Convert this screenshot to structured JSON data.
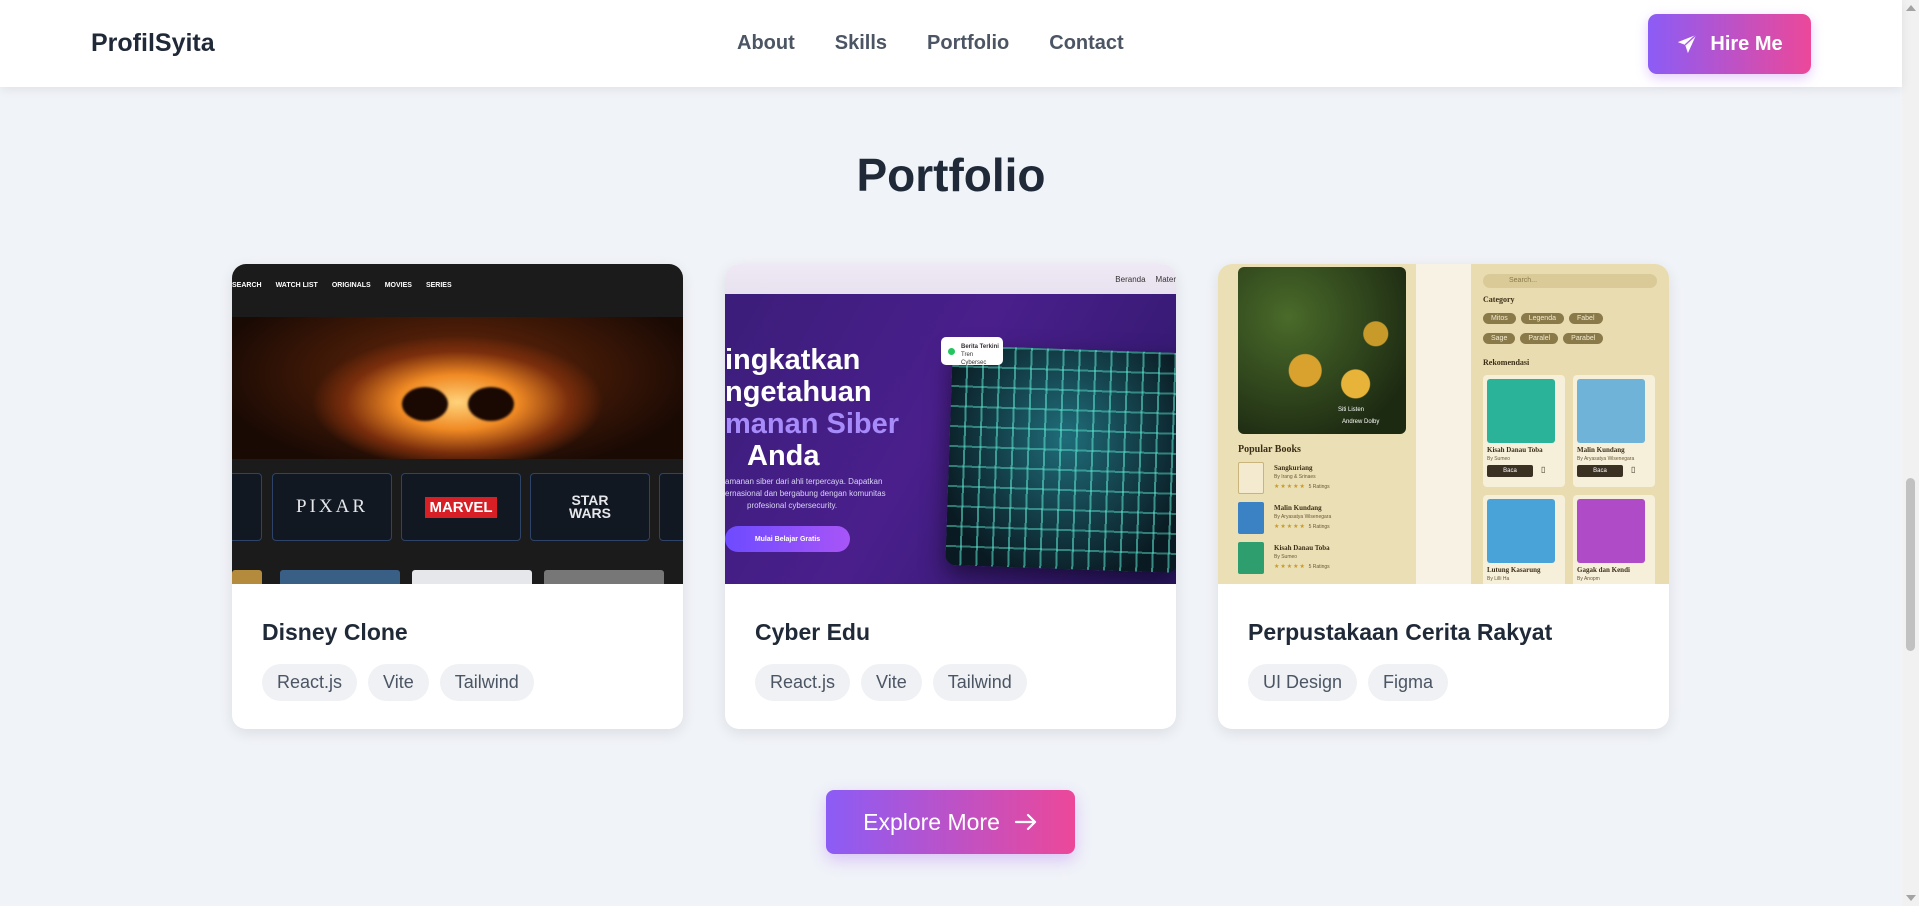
{
  "nav": {
    "logo": "ProfilSyita",
    "links": [
      "About",
      "Skills",
      "Portfolio",
      "Contact"
    ],
    "hire_label": "Hire Me"
  },
  "section": {
    "title": "Portfolio"
  },
  "projects": [
    {
      "title": "Disney Clone",
      "tags": [
        "React.js",
        "Vite",
        "Tailwind"
      ]
    },
    {
      "title": "Cyber Edu",
      "tags": [
        "React.js",
        "Vite",
        "Tailwind"
      ]
    },
    {
      "title": "Perpustakaan Cerita Rakyat",
      "tags": [
        "UI Design",
        "Figma"
      ]
    }
  ],
  "thumbs": {
    "disney": {
      "menu": [
        "SEARCH",
        "WATCH LIST",
        "ORIGINALS",
        "MOVIES",
        "SERIES"
      ],
      "brands": [
        "PIXAR",
        "MARVEL",
        "STAR WARS"
      ]
    },
    "cyber": {
      "nav": [
        "Beranda",
        "Mater"
      ],
      "line1": "ingkatkan",
      "line2": "ngetahuan",
      "line3": "manan Siber",
      "line4": "Anda",
      "para1": "amanan siber dari ahli terpercaya. Dapatkan",
      "para2": "ernasional dan bergabung dengan komunitas",
      "para3": "profesional cybersecurity.",
      "cta": "Mulai Belajar Gratis",
      "badge_title": "Berita Terkini",
      "badge_sub": "Tren Cybersec"
    },
    "library": {
      "listen": "Siti Listen",
      "author": "Andrew Dolby",
      "popular": "Popular Books",
      "popular_books": [
        {
          "title": "Sangkuriang",
          "by": "By Irang & Srinaes",
          "rating": "5 Ratings"
        },
        {
          "title": "Malin Kundang",
          "by": "By Aryasatya Wisenegara",
          "rating": "5 Ratings"
        },
        {
          "title": "Kisah Danau Toba",
          "by": "By Sumeo",
          "rating": "5 Ratings"
        }
      ],
      "search_placeholder": "Search...",
      "category_label": "Category",
      "categories_row1": [
        "Mitos",
        "Legenda",
        "Fabel"
      ],
      "categories_row2": [
        "Sage",
        "Paralel",
        "Parabel"
      ],
      "recommend_label": "Rekomendasi",
      "recommend": [
        {
          "title": "Kisah Danau Toba",
          "by": "By Sumeo",
          "cover_text": "Kisah Danau Toba",
          "btn": "Baca"
        },
        {
          "title": "Malin Kundang",
          "by": "By Aryasatya Wisenegara",
          "cover_text": "MALIN KUNDANG",
          "btn": "Baca"
        },
        {
          "title": "Lutung Kasarung",
          "by": "By Lilli Ha",
          "cover_text": "LUTUNG KASARUNG",
          "btn": ""
        },
        {
          "title": "Gagak dan Kendi",
          "by": "By Anopm",
          "cover_text": "Gagak dan Kendi",
          "btn": ""
        }
      ]
    }
  },
  "explore": {
    "label": "Explore More"
  },
  "colors": {
    "accent_from": "#8b5cf6",
    "accent_to": "#ec4899",
    "background": "#f0f3f8"
  }
}
